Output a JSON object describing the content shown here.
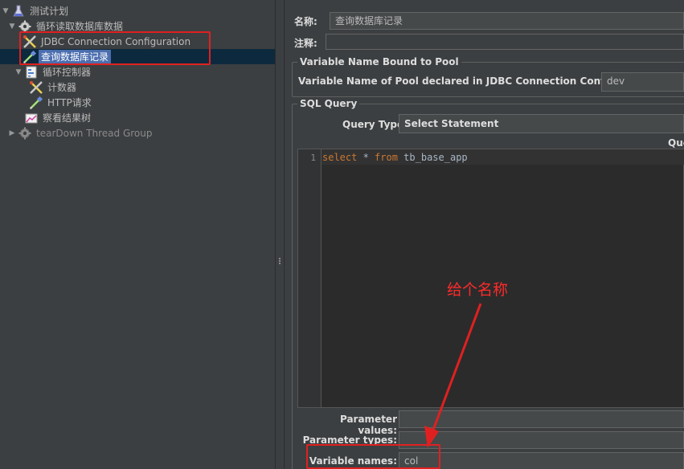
{
  "tree": {
    "items": [
      {
        "label": "测试计划",
        "icon": "test-plan-icon"
      },
      {
        "label": "循环读取数据库数据",
        "icon": "thread-group-gear-icon"
      },
      {
        "label": "JDBC Connection Configuration",
        "icon": "config-element-icon"
      },
      {
        "label": "查询数据库记录",
        "icon": "sampler-pipette-icon"
      },
      {
        "label": "循环控制器",
        "icon": "loop-controller-icon"
      },
      {
        "label": "计数器",
        "icon": "counter-config-icon"
      },
      {
        "label": "HTTP请求",
        "icon": "http-sampler-pipette-icon"
      },
      {
        "label": "察看结果树",
        "icon": "listener-chart-icon"
      },
      {
        "label": "tearDown Thread Group",
        "icon": "teardown-gear-icon"
      }
    ]
  },
  "form": {
    "name_label": "名称:",
    "name_value": "查询数据库记录",
    "comment_label": "注释:",
    "comment_value": "",
    "pool_group_title": "Variable Name Bound to Pool",
    "pool_label": "Variable Name of Pool declared in JDBC Connection Configuration:",
    "pool_value": "dev",
    "sql_group_title": "SQL Query",
    "query_type_label": "Query Type:",
    "query_type_value": "Select Statement",
    "query_header": "Que",
    "line_number": "1",
    "sql_select": "select",
    "sql_star": " * ",
    "sql_from": "from",
    "sql_table": " tb_base_app",
    "param_values_label": "Parameter values:",
    "param_types_label": "Parameter types:",
    "variable_names_label": "Variable names:",
    "variable_names_value": "col"
  },
  "annotation": {
    "text": "给个名称",
    "color": "#e02020"
  },
  "colors": {
    "selection": "#4b6eaf",
    "background": "#3c3f41",
    "editor_bg": "#2b2b2b",
    "keyword": "#cc7832"
  }
}
